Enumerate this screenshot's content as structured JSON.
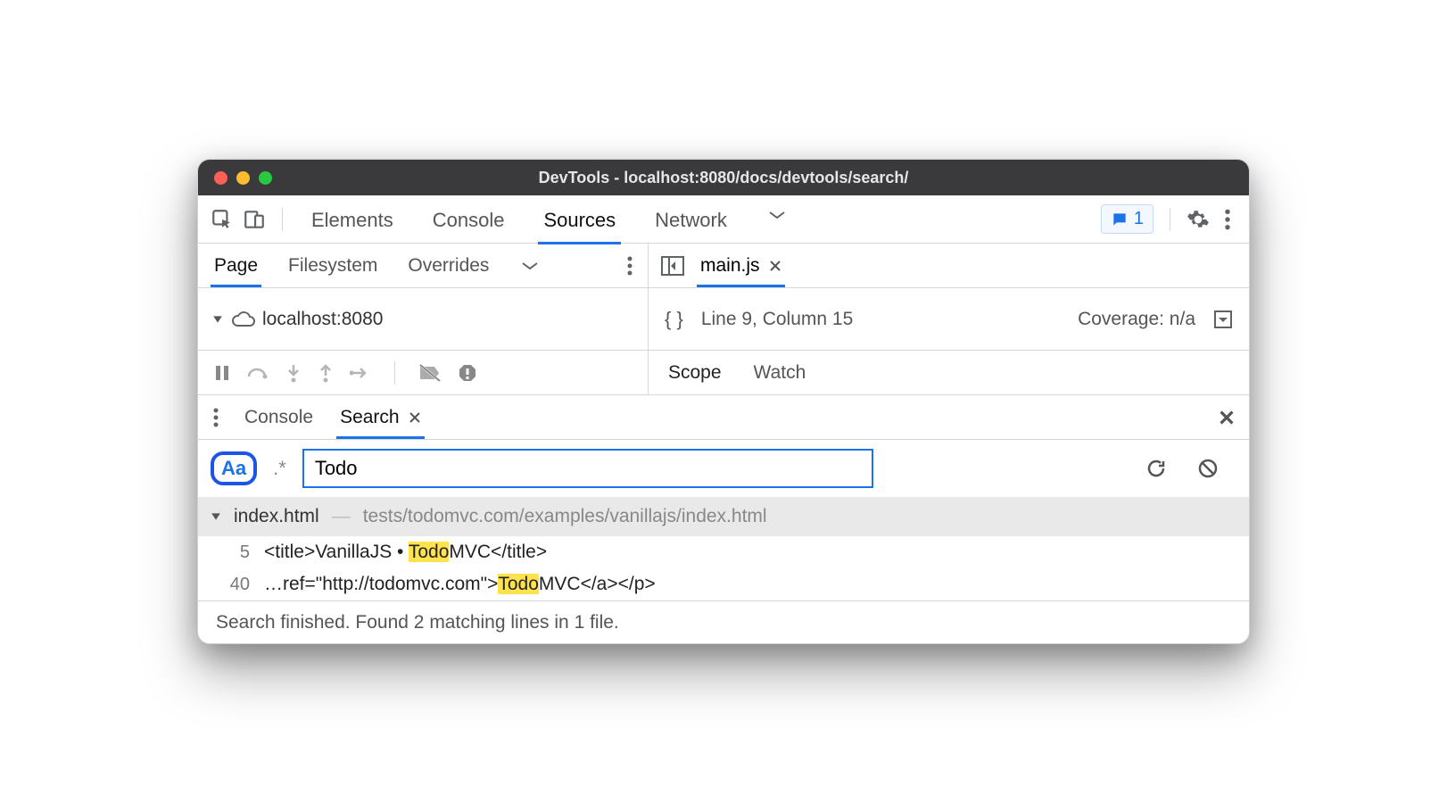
{
  "window": {
    "title": "DevTools - localhost:8080/docs/devtools/search/"
  },
  "top_tabs": {
    "elements": "Elements",
    "console": "Console",
    "sources": "Sources",
    "network": "Network"
  },
  "feedback": {
    "count": "1"
  },
  "nav": {
    "page": "Page",
    "filesystem": "Filesystem",
    "overrides": "Overrides"
  },
  "tree": {
    "host": "localhost:8080"
  },
  "editor": {
    "filename": "main.js",
    "position": "Line 9, Column 15",
    "coverage": "Coverage: n/a"
  },
  "debugger_tabs": {
    "scope": "Scope",
    "watch": "Watch"
  },
  "drawer": {
    "console": "Console",
    "search": "Search"
  },
  "search": {
    "case_label": "Aa",
    "regex_label": ".*",
    "value": "Todo"
  },
  "results": {
    "file": "index.html",
    "path": "tests/todomvc.com/examples/vanillajs/index.html",
    "lines": [
      {
        "n": "5",
        "pre": "<title>VanillaJS • ",
        "m": "Todo",
        "post": "MVC</title>"
      },
      {
        "n": "40",
        "pre": "…ref=\"http://todomvc.com\">",
        "m": "Todo",
        "post": "MVC</a></p>"
      }
    ]
  },
  "status": "Search finished.  Found 2 matching lines in 1 file."
}
